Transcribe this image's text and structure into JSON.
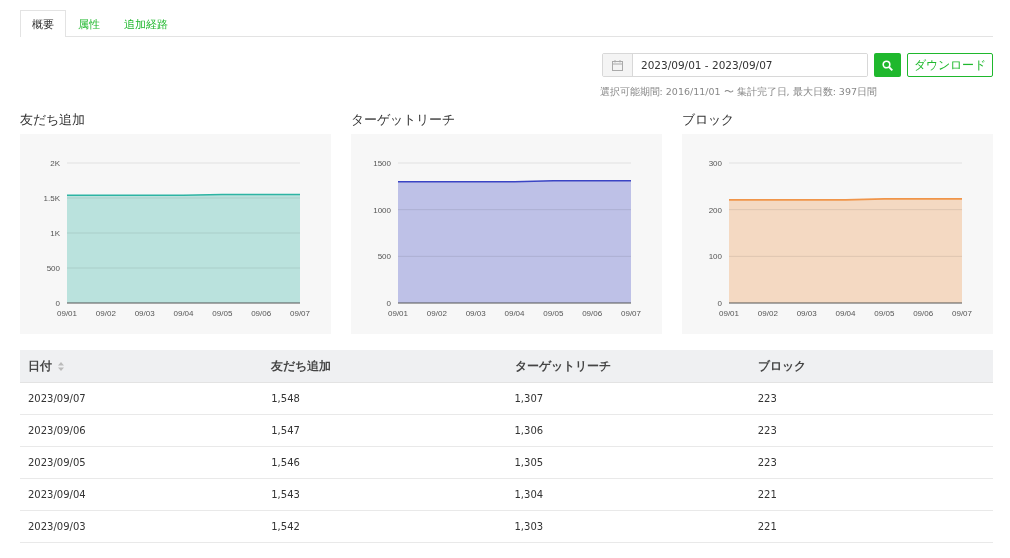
{
  "tabs": [
    {
      "label": "概要",
      "selected": true
    },
    {
      "label": "属性",
      "selected": false
    },
    {
      "label": "追加経路",
      "selected": false
    }
  ],
  "date_range": {
    "value": "2023/09/01 - 2023/09/07"
  },
  "download_button": "ダウンロード",
  "range_note": "選択可能期間: 2016/11/01 〜 集計完了日, 最大日数: 397日間",
  "charts": [
    {
      "title": "友だち追加",
      "chart_data": {
        "type": "area",
        "x": [
          "09/01",
          "09/02",
          "09/03",
          "09/04",
          "09/05",
          "09/06",
          "09/07"
        ],
        "series": [
          {
            "color": "#2db4a3",
            "values": [
              1540,
              1540,
              1540,
              1540,
              1550,
              1550,
              1550
            ]
          }
        ],
        "grid": true,
        "ylim": [
          0,
          2000
        ],
        "yticks": [
          {
            "value": 0,
            "label": "0"
          },
          {
            "value": 500,
            "label": "500"
          },
          {
            "value": 1000,
            "label": "1K"
          },
          {
            "value": 1500,
            "label": "1.5K"
          },
          {
            "value": 2000,
            "label": "2K"
          }
        ]
      }
    },
    {
      "title": "ターゲットリーチ",
      "chart_data": {
        "type": "area",
        "x": [
          "09/01",
          "09/02",
          "09/03",
          "09/04",
          "09/05",
          "09/06",
          "09/07"
        ],
        "series": [
          {
            "color": "#3a44c4",
            "values": [
              1300,
              1300,
              1300,
              1300,
              1310,
              1310,
              1310
            ]
          }
        ],
        "grid": true,
        "ylim": [
          0,
          1500
        ],
        "yticks": [
          0,
          500,
          1000,
          1500
        ]
      }
    },
    {
      "title": "ブロック",
      "chart_data": {
        "type": "area",
        "x": [
          "09/01",
          "09/02",
          "09/03",
          "09/04",
          "09/05",
          "09/06",
          "09/07"
        ],
        "series": [
          {
            "color": "#f0954a",
            "values": [
              221,
              221,
              221,
              221,
              223,
              223,
              223
            ]
          }
        ],
        "grid": true,
        "ylim": [
          0,
          300
        ],
        "yticks": [
          0,
          100,
          200,
          300
        ]
      }
    }
  ],
  "table": {
    "columns": [
      {
        "label": "日付",
        "sortable": true
      },
      {
        "label": "友だち追加",
        "sortable": false
      },
      {
        "label": "ターゲットリーチ",
        "sortable": false
      },
      {
        "label": "ブロック",
        "sortable": false
      }
    ],
    "rows": [
      [
        "2023/09/07",
        "1,548",
        "1,307",
        "223"
      ],
      [
        "2023/09/06",
        "1,547",
        "1,306",
        "223"
      ],
      [
        "2023/09/05",
        "1,546",
        "1,305",
        "223"
      ],
      [
        "2023/09/04",
        "1,543",
        "1,304",
        "221"
      ],
      [
        "2023/09/03",
        "1,542",
        "1,303",
        "221"
      ]
    ]
  }
}
